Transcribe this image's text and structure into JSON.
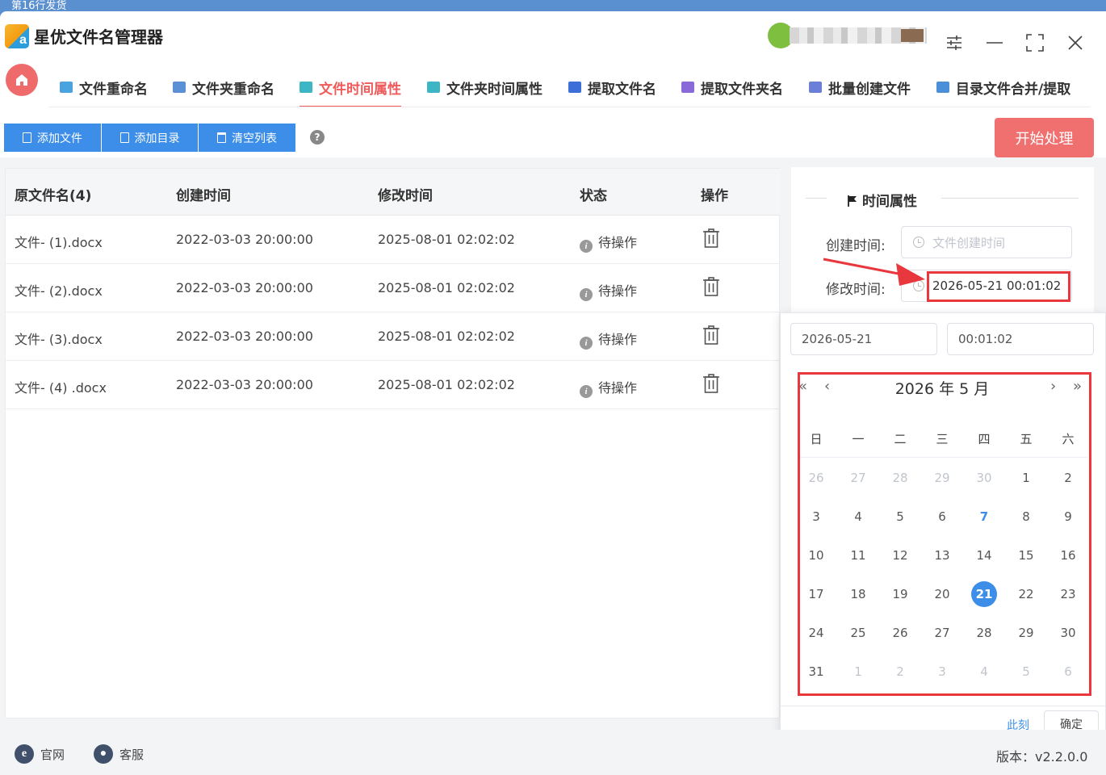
{
  "desktop": {
    "top_text": "第16行发货"
  },
  "app": {
    "title": "星优文件名管理器",
    "logo_letter": "a"
  },
  "tabs": [
    {
      "label": "文件重命名",
      "color": "#4aa3df"
    },
    {
      "label": "文件夹重命名",
      "color": "#5b8fd6"
    },
    {
      "label": "文件时间属性",
      "color": "#3cb6c4"
    },
    {
      "label": "文件夹时间属性",
      "color": "#3cb6c4"
    },
    {
      "label": "提取文件名",
      "color": "#3d6fd8"
    },
    {
      "label": "提取文件夹名",
      "color": "#8a6ad8"
    },
    {
      "label": "批量创建文件",
      "color": "#6b7fd8"
    },
    {
      "label": "目录文件合并/提取",
      "color": "#4a8fd8"
    }
  ],
  "toolbar": {
    "add_file": "添加文件",
    "add_dir": "添加目录",
    "clear_list": "清空列表",
    "help": "?",
    "start": "开始处理"
  },
  "table": {
    "headers": [
      "原文件名(4)",
      "创建时间",
      "修改时间",
      "状态",
      "操作"
    ],
    "rows": [
      {
        "name": "文件- (1).docx",
        "created": "2022-03-03 20:00:00",
        "modified": "2025-08-01 02:02:02",
        "status": "待操作"
      },
      {
        "name": "文件- (2).docx",
        "created": "2022-03-03 20:00:00",
        "modified": "2025-08-01 02:02:02",
        "status": "待操作"
      },
      {
        "name": "文件- (3).docx",
        "created": "2022-03-03 20:00:00",
        "modified": "2025-08-01 02:02:02",
        "status": "待操作"
      },
      {
        "name": "文件- (4) .docx",
        "created": "2022-03-03 20:00:00",
        "modified": "2025-08-01 02:02:02",
        "status": "待操作"
      }
    ]
  },
  "panel": {
    "title": "时间属性",
    "create_label": "创建时间:",
    "create_placeholder": "文件创建时间",
    "modify_label": "修改时间:",
    "modify_value": "2026-05-21 00:01:02"
  },
  "picker": {
    "date_value": "2026-05-21",
    "time_value": "00:01:02",
    "nav_prev_year": "«",
    "nav_prev_month": "‹",
    "nav_next_month": "›",
    "nav_next_year": "»",
    "title": "2026 年  5 月",
    "weekdays": [
      "日",
      "一",
      "二",
      "三",
      "四",
      "五",
      "六"
    ],
    "weeks": [
      [
        "26",
        "27",
        "28",
        "29",
        "30",
        "1",
        "2"
      ],
      [
        "3",
        "4",
        "5",
        "6",
        "7",
        "8",
        "9"
      ],
      [
        "10",
        "11",
        "12",
        "13",
        "14",
        "15",
        "16"
      ],
      [
        "17",
        "18",
        "19",
        "20",
        "21",
        "22",
        "23"
      ],
      [
        "24",
        "25",
        "26",
        "27",
        "28",
        "29",
        "30"
      ],
      [
        "31",
        "1",
        "2",
        "3",
        "4",
        "5",
        "6"
      ]
    ],
    "now_label": "此刻",
    "confirm_label": "确定"
  },
  "footer": {
    "website": "官网",
    "support": "客服",
    "version": "版本：v2.2.0.0"
  },
  "colors": {
    "accent_red": "#ef5b5b",
    "primary_blue": "#3d8ee8",
    "highlight_box": "#e8383d"
  }
}
